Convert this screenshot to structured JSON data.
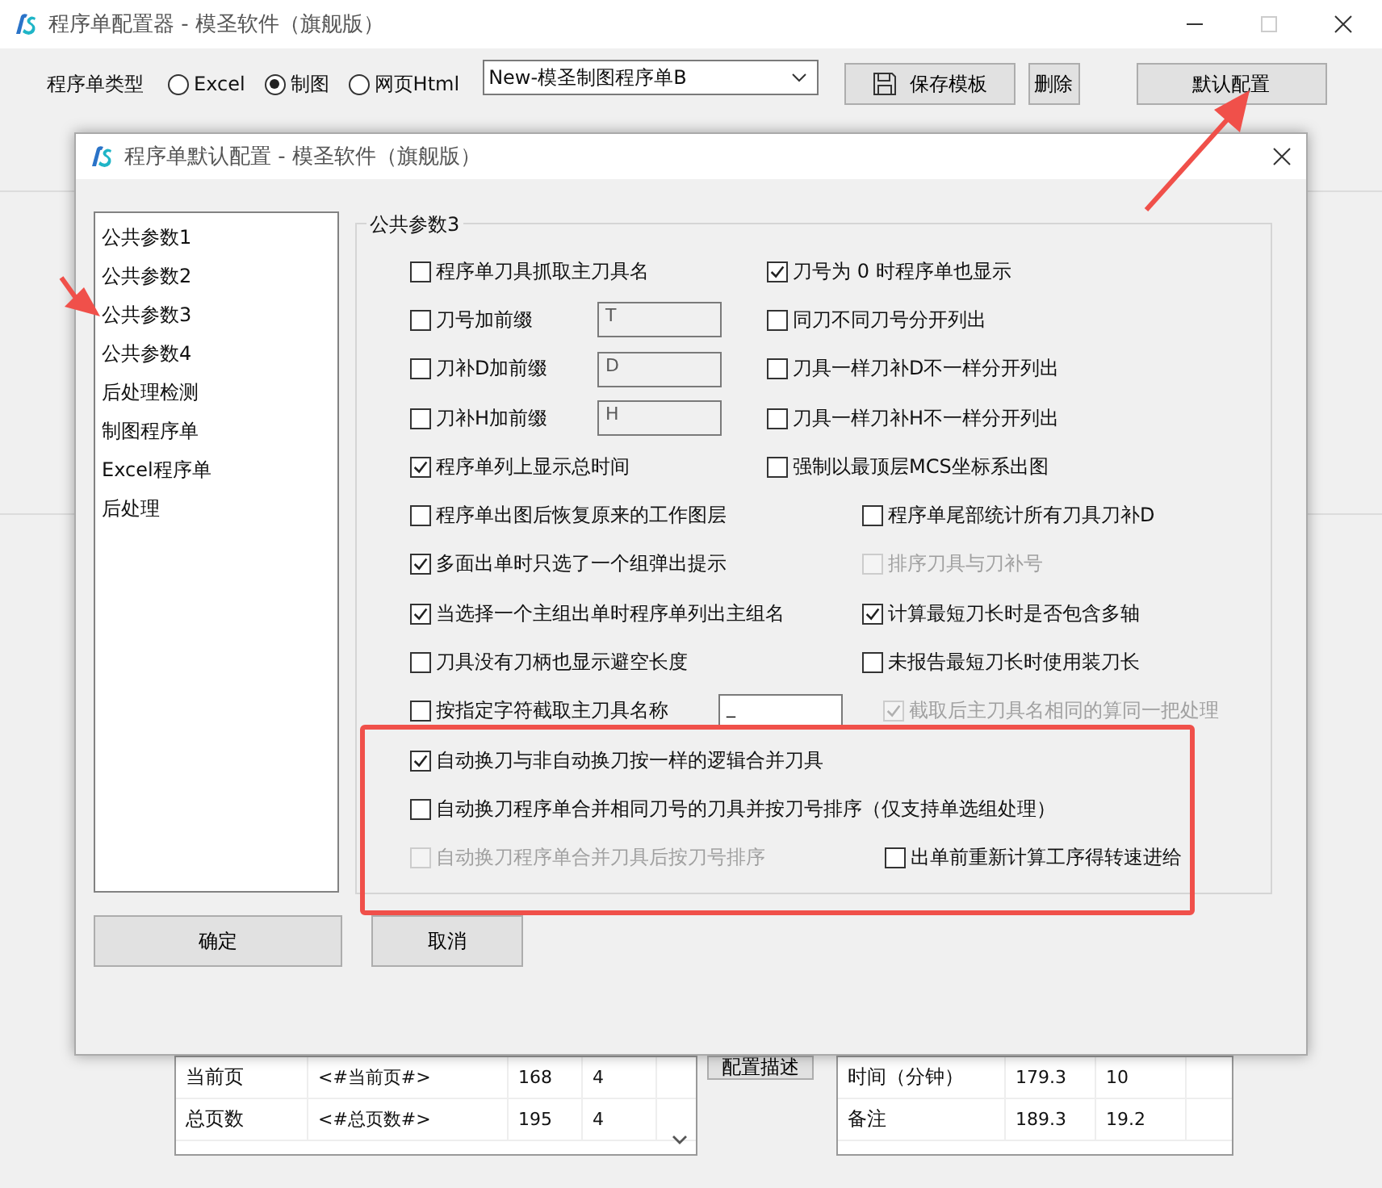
{
  "window": {
    "title": "程序单配置器 - 模圣软件（旗舰版）"
  },
  "toolbar": {
    "type_label": "程序单类型",
    "types": [
      {
        "label": "Excel",
        "selected": false
      },
      {
        "label": "制图",
        "selected": true
      },
      {
        "label": "网页Html",
        "selected": false
      }
    ],
    "template": {
      "value": "New-模圣制图程序单B"
    },
    "buttons": [
      {
        "label": "保存模板",
        "kind": "save"
      },
      {
        "label": "删除",
        "kind": "plain"
      },
      {
        "label": "默认配置",
        "kind": "wide"
      }
    ]
  },
  "dialog": {
    "title": "程序单默认配置 - 模圣软件（旗舰版）",
    "nav": [
      "公共参数1",
      "公共参数2",
      "公共参数3",
      "公共参数4",
      "后处理检测",
      "制图程序单",
      "Excel程序单",
      "后处理"
    ],
    "group": {
      "title": "公共参数3",
      "rows": [
        {
          "kind": "pair",
          "left": {
            "label": "程序单刀具抓取主刀具名",
            "checked": false,
            "disabled": false
          },
          "right": {
            "label": "刀号为 0 时程序单也显示",
            "checked": true,
            "disabled": false
          }
        },
        {
          "kind": "prefix",
          "left": {
            "label": "刀号加前缀",
            "checked": false,
            "disabled": false
          },
          "field": {
            "value": "T",
            "disabled": true
          },
          "right": {
            "label": "同刀不同刀号分开列出",
            "checked": false,
            "disabled": false
          }
        },
        {
          "kind": "prefix",
          "left": {
            "label": "刀补D加前缀",
            "checked": false,
            "disabled": false
          },
          "field": {
            "value": "D",
            "disabled": true
          },
          "right": {
            "label": "刀具一样刀补D不一样分开列出",
            "checked": false,
            "disabled": false
          }
        },
        {
          "kind": "prefix",
          "left": {
            "label": "刀补H加前缀",
            "checked": false,
            "disabled": false
          },
          "field": {
            "value": "H",
            "disabled": true
          },
          "right": {
            "label": "刀具一样刀补H不一样分开列出",
            "checked": false,
            "disabled": false
          }
        },
        {
          "kind": "pair",
          "left": {
            "label": "程序单列上显示总时间",
            "checked": true,
            "disabled": false
          },
          "right": {
            "label": "强制以最顶层MCS坐标系出图",
            "checked": false,
            "disabled": false
          }
        },
        {
          "kind": "wide",
          "left": {
            "label": "程序单出图后恢复原来的工作图层",
            "checked": false,
            "disabled": false
          },
          "right": {
            "label": "程序单尾部统计所有刀具刀补D",
            "checked": false,
            "disabled": false
          }
        },
        {
          "kind": "wide",
          "left": {
            "label": "多面出单时只选了一个组弹出提示",
            "checked": true,
            "disabled": false
          },
          "right": {
            "label": "排序刀具与刀补号",
            "checked": false,
            "disabled": true
          }
        },
        {
          "kind": "wide",
          "left": {
            "label": "当选择一个主组出单时程序单列出主组名",
            "checked": true,
            "disabled": false
          },
          "right": {
            "label": "计算最短刀长时是否包含多轴",
            "checked": true,
            "disabled": false
          }
        },
        {
          "kind": "wide",
          "left": {
            "label": "刀具没有刀柄也显示避空长度",
            "checked": false,
            "disabled": false
          },
          "right": {
            "label": "未报告最短刀长时使用装刀长",
            "checked": false,
            "disabled": false
          }
        },
        {
          "kind": "field-pair",
          "left": {
            "label": "按指定字符截取主刀具名称",
            "checked": false,
            "disabled": false
          },
          "field": {
            "value": "_",
            "disabled": false
          },
          "right": {
            "label": "截取后主刀具名相同的算同一把处理",
            "checked": true,
            "disabled": true
          }
        },
        {
          "kind": "single",
          "left": {
            "label": "自动换刀与非自动换刀按一样的逻辑合并刀具",
            "checked": true,
            "disabled": false
          }
        },
        {
          "kind": "single",
          "left": {
            "label": "自动换刀程序单合并相同刀号的刀具并按刀号排序（仅支持单选组处理）",
            "checked": false,
            "disabled": false
          }
        },
        {
          "kind": "late-pair",
          "left": {
            "label": "自动换刀程序单合并刀具后按刀号排序",
            "checked": false,
            "disabled": true
          },
          "right": {
            "label": "出单前重新计算工序得转速进给",
            "checked": false,
            "disabled": false
          }
        }
      ]
    },
    "buttons": [
      "确定",
      "取消"
    ]
  },
  "tables": [
    {
      "rows": [
        [
          "当前页",
          "<#当前页#>",
          "168",
          "4"
        ],
        [
          "总页数",
          "<#总页数#>",
          "195",
          "4"
        ]
      ]
    },
    {
      "rows": [
        [
          "时间（分钟）",
          "179.3",
          "10"
        ],
        [
          "备注",
          "189.3",
          "19.2"
        ]
      ]
    }
  ],
  "describe_button": "配置描述"
}
